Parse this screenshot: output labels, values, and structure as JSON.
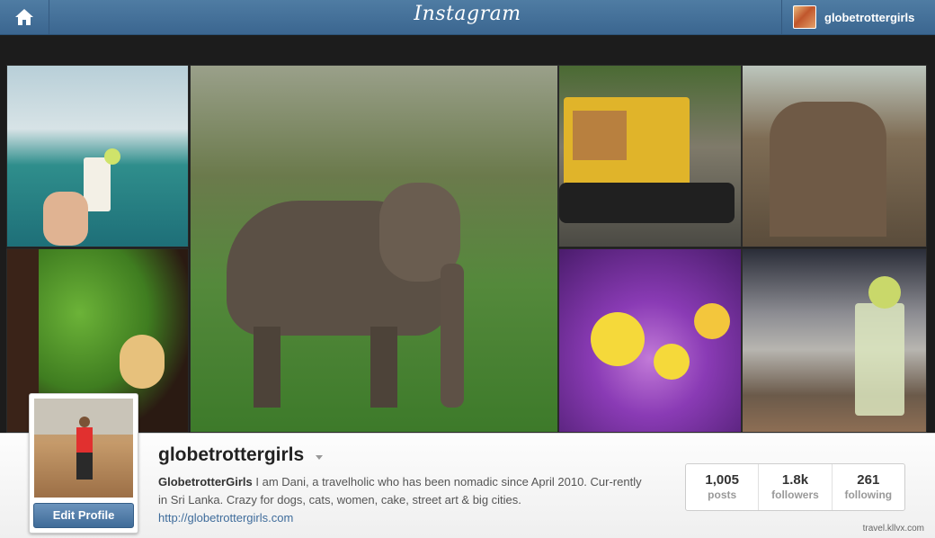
{
  "topbar": {
    "logo": "Instagram",
    "username": "globetrottergirls"
  },
  "profile": {
    "username": "globetrottergirls",
    "bio_name": "GlobetrotterGirls",
    "bio_text": "I am Dani, a travelholic who has been nomadic since April 2010. Cur-rently in Sri Lanka. Crazy for dogs, cats, women, cake, street art & big cities.",
    "link": "http://globetrottergirls.com",
    "edit_label": "Edit Profile",
    "stats": [
      {
        "value": "1,005",
        "label": "posts"
      },
      {
        "value": "1.8k",
        "label": "followers"
      },
      {
        "value": "261",
        "label": "following"
      }
    ]
  },
  "watermark": "travel.kllvx.com",
  "icons": {
    "home": "home-icon",
    "dropdown": "chevron-down-icon"
  }
}
